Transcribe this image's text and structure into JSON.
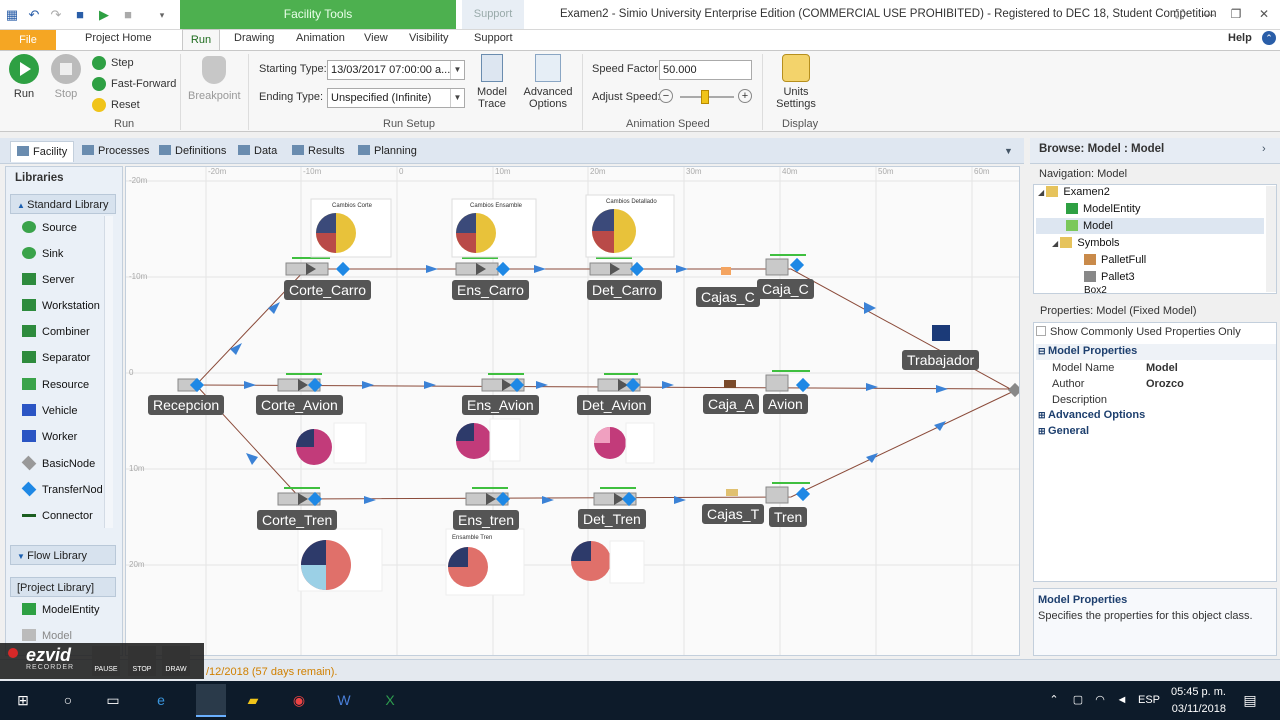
{
  "window": {
    "title": "Examen2 - Simio University Enterprise Edition (COMMERCIAL USE PROHIBITED) - Registered to DEC 18, Student Competition",
    "contextual_tab": "Facility Tools",
    "support_tab": "Support",
    "help": "Help"
  },
  "ribbon_tabs": [
    "File",
    "Project Home",
    "Run",
    "Drawing",
    "Animation",
    "View",
    "Visibility",
    "Support"
  ],
  "ribbon": {
    "run": {
      "run": "Run",
      "stop": "Stop",
      "step": "Step",
      "fast_forward": "Fast-Forward",
      "reset": "Reset",
      "group": "Run"
    },
    "breakpoint": "Breakpoint",
    "setup": {
      "starting_label": "Starting Type:",
      "starting_value": "13/03/2017 07:00:00 a...",
      "ending_label": "Ending Type:",
      "ending_value": "Unspecified (Infinite)",
      "model_trace": "Model\nTrace",
      "advanced": "Advanced\nOptions",
      "group": "Run Setup"
    },
    "animation": {
      "speed_label": "Speed Factor:",
      "speed_value": "50.000",
      "adjust_label": "Adjust Speed:",
      "group": "Animation Speed"
    },
    "display": {
      "units": "Units\nSettings",
      "group": "Display"
    }
  },
  "view_tabs": [
    "Facility",
    "Processes",
    "Definitions",
    "Data",
    "Results",
    "Planning"
  ],
  "libraries": {
    "title": "Libraries",
    "standard": "Standard Library",
    "items": [
      "Source",
      "Sink",
      "Server",
      "Workstation",
      "Combiner",
      "Separator",
      "Resource",
      "Vehicle",
      "Worker",
      "BasicNode",
      "TransferNod",
      "Connector"
    ],
    "flow": "Flow Library",
    "project": "[Project Library]",
    "project_items": [
      "ModelEntity",
      "Model"
    ]
  },
  "canvas": {
    "rulers_top": [
      "-20m",
      "-10m",
      "0",
      "10m",
      "20m",
      "30m",
      "40m",
      "50m",
      "60m"
    ],
    "rulers_left": [
      "-20m",
      "-10m",
      "0",
      "10m",
      "20m"
    ],
    "objects": {
      "recepcion": "Recepcion",
      "corte_carro": "Corte_Carro",
      "ens_carro": "Ens_Carro",
      "det_carro": "Det_Carro",
      "cajas_c": "Cajas_C",
      "caja_c": "Caja_C",
      "corte_avion": "Corte_Avion",
      "ens_avion": "Ens_Avion",
      "det_avion": "Det_Avion",
      "caja_a": "Caja_A",
      "avion": "Avion",
      "corte_tren": "Corte_Tren",
      "ens_tren": "Ens_tren",
      "det_tren": "Det_Tren",
      "cajas_t": "Cajas_T",
      "tren": "Tren",
      "trabajador": "Trabajador"
    },
    "chart_titles": [
      "Cambios Corte",
      "Cambios Ensamble",
      "Cambios Detallado",
      "Ensamble Tren"
    ]
  },
  "right": {
    "browse": "Browse: Model : Model",
    "navigation": "Navigation: Model",
    "tree": [
      "Examen2",
      "ModelEntity",
      "Model",
      "Symbols",
      "PalletFull",
      "Pallet3",
      "Box2"
    ],
    "props_header": "Properties: Model (Fixed Model)",
    "show_common": "Show Commonly Used Properties Only",
    "cat_model": "Model Properties",
    "rows": [
      {
        "k": "Model Name",
        "v": "Model"
      },
      {
        "k": "Author",
        "v": "Orozco"
      },
      {
        "k": "Description",
        "v": ""
      }
    ],
    "cat_adv": "Advanced Options",
    "cat_gen": "General",
    "desc_title": "Model Properties",
    "desc_text": "Specifies the properties for this object class."
  },
  "status": {
    "text": "/12/2018 (57 days remain)."
  },
  "ezvid": {
    "logo": "ezvid",
    "sub": "RECORDER",
    "pause": "PAUSE",
    "stop": "STOP",
    "draw": "DRAW"
  },
  "taskbar": {
    "lang": "ESP",
    "time": "05:45 p. m.",
    "date": "03/11/2018"
  }
}
